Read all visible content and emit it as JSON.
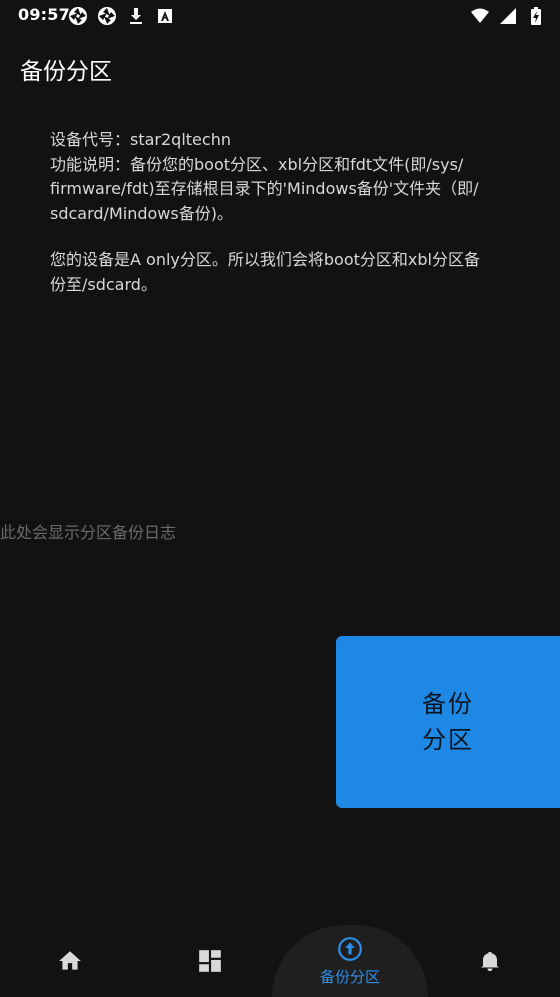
{
  "status_bar": {
    "time": "09:57",
    "left_icons": [
      "aperture-icon",
      "aperture-icon",
      "download-icon",
      "font-a-icon"
    ],
    "right_icons": [
      "wifi-icon",
      "signal-icon",
      "battery-charging-icon"
    ]
  },
  "page": {
    "title": "备份分区"
  },
  "info": {
    "line1": "设备代号：star2qltechn",
    "line2": "功能说明：备份您的boot分区、xbl分区和fdt文件(即/sys/",
    "line3": "firmware/fdt)至存储根目录下的'Mindows备份'文件夹（即/",
    "line4": "sdcard/Mindows备份)。",
    "line5": "您的设备是A only分区。所以我们会将boot分区和xbl分区备",
    "line6": "份至/sdcard。"
  },
  "log": {
    "placeholder": "此处会显示分区备份日志"
  },
  "action": {
    "button_line1": "备份",
    "button_line2": "分区",
    "color": "#1e88e5"
  },
  "bottom_nav": {
    "active_label": "备份分区",
    "active_color": "#2f8fe8",
    "items": [
      "home-icon",
      "dashboard-icon",
      "upload-circle-icon",
      "bell-icon"
    ]
  }
}
